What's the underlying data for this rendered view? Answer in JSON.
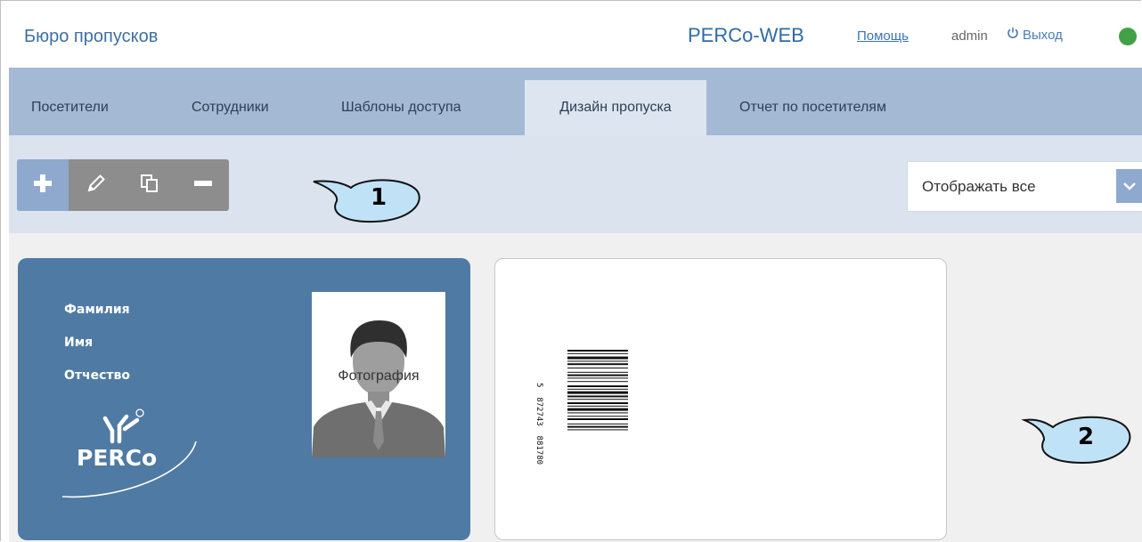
{
  "header": {
    "title": "Бюро пропусков",
    "brand": "PERCo-WEB",
    "help_link": "Помощь",
    "user": "admin",
    "logout": "Выход",
    "status_color": "#43a047"
  },
  "tabs": [
    {
      "label": "Посетители"
    },
    {
      "label": "Сотрудники"
    },
    {
      "label": "Шаблоны доступа"
    },
    {
      "label": "Дизайн пропуска",
      "active": true
    },
    {
      "label": "Отчет по посетителям"
    }
  ],
  "toolbar": {
    "buttons": [
      "plus-icon",
      "pencil-icon",
      "copy-icon",
      "minus-icon"
    ],
    "filter_value": "Отображать все"
  },
  "annotations": [
    "1",
    "2"
  ],
  "cards": [
    {
      "fields": [
        "Фамилия",
        "Имя",
        "Отчество"
      ],
      "photo_label": "Фотография",
      "logo_text": "PERCo"
    },
    {
      "barcode_text": "5  872743  881780"
    }
  ],
  "colors": {
    "tab_bar": "#a4b9d4",
    "toolbar_bg": "#dbe3ee",
    "card_blue": "#4f7aa3",
    "accent": "#8ea9cd"
  }
}
